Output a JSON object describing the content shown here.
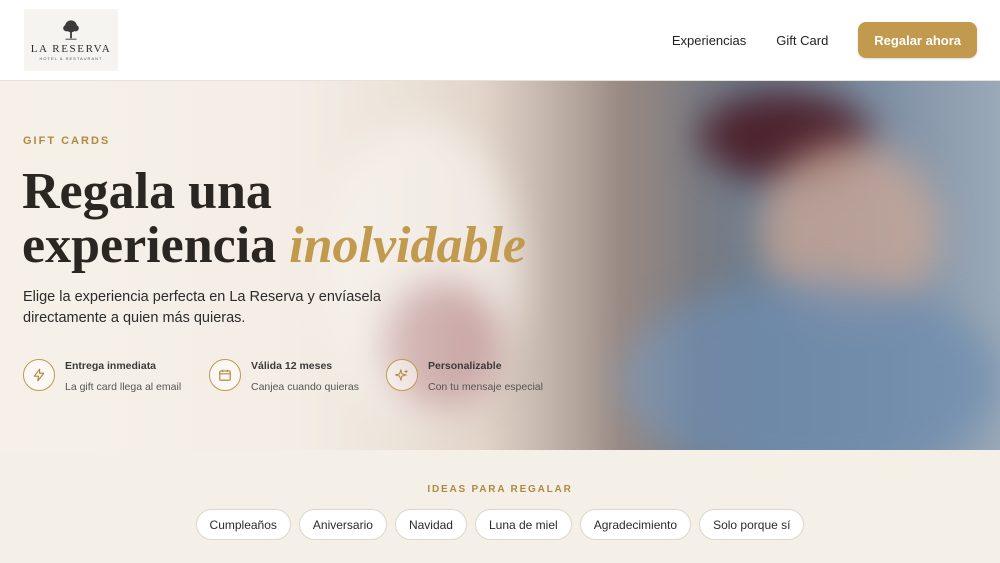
{
  "brand": {
    "name": "LA RESERVA",
    "tagline": "HOTEL & RESTAURANT",
    "accent_color": "#c19a4e"
  },
  "nav": {
    "links": [
      "Experiencias",
      "Gift Card"
    ],
    "cta_label": "Regalar ahora"
  },
  "hero": {
    "eyebrow": "GIFT CARDS",
    "title_line1": "Regala una",
    "title_line2": "experiencia",
    "title_accent": "inolvidable",
    "subtitle": "Elige la experiencia perfecta en La Reserva y envíasela directamente a quien más quieras.",
    "features": [
      {
        "icon": "lightning-icon",
        "title": "Entrega inmediata",
        "desc": "La gift card llega al email"
      },
      {
        "icon": "calendar-icon",
        "title": "Válida 12 meses",
        "desc": "Canjea cuando quieras"
      },
      {
        "icon": "sparkles-icon",
        "title": "Personalizable",
        "desc": "Con tu mensaje especial"
      }
    ]
  },
  "ideas": {
    "label": "IDEAS PARA REGALAR",
    "chips": [
      "Cumpleaños",
      "Aniversario",
      "Navidad",
      "Luna de miel",
      "Agradecimiento",
      "Solo porque sí"
    ]
  }
}
